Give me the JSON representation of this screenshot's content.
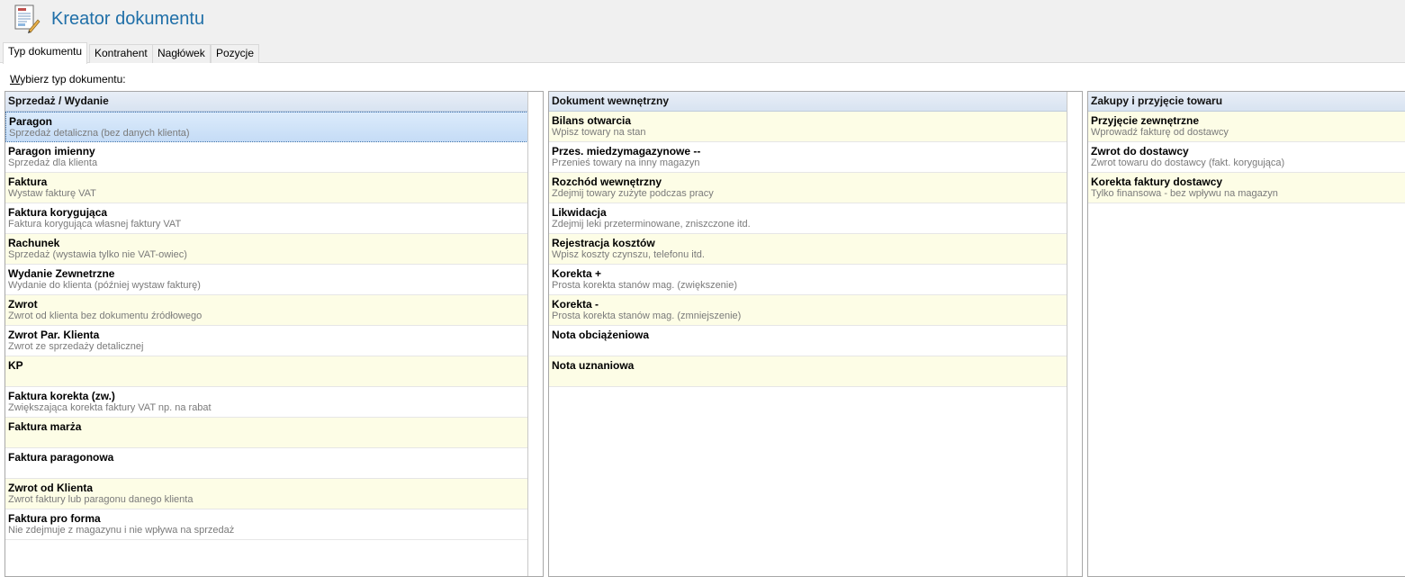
{
  "app": {
    "title": "Kreator dokumentu",
    "icon": "document-wizard-icon"
  },
  "tabs": [
    {
      "label": "Typ dokumentu",
      "active": true
    },
    {
      "label": "Kontrahent",
      "active": false
    },
    {
      "label": "Nagłówek",
      "active": false
    },
    {
      "label": "Pozycje",
      "active": false
    }
  ],
  "prompt": {
    "accel": "W",
    "rest": "ybierz typ dokumentu:"
  },
  "panels": [
    {
      "header": "Sprzedaż / Wydanie",
      "items": [
        {
          "title": "Paragon",
          "desc": "Sprzedaż detaliczna (bez danych klienta)",
          "selected": true
        },
        {
          "title": "Paragon imienny",
          "desc": "Sprzedaż dla klienta"
        },
        {
          "title": "Faktura",
          "desc": "Wystaw fakturę VAT"
        },
        {
          "title": "Faktura korygująca",
          "desc": "Faktura korygująca własnej faktury VAT"
        },
        {
          "title": "Rachunek",
          "desc": "Sprzedaż (wystawia tylko nie VAT-owiec)"
        },
        {
          "title": "Wydanie Zewnetrzne",
          "desc": "Wydanie do klienta (później wystaw fakturę)"
        },
        {
          "title": "Zwrot",
          "desc": "Zwrot od klienta bez dokumentu źródłowego"
        },
        {
          "title": "Zwrot Par. Klienta",
          "desc": "Zwrot ze sprzedaży detalicznej"
        },
        {
          "title": "KP",
          "desc": ""
        },
        {
          "title": "Faktura korekta (zw.)",
          "desc": "Zwiększająca korekta faktury VAT np. na rabat"
        },
        {
          "title": "Faktura marża",
          "desc": ""
        },
        {
          "title": "Faktura paragonowa",
          "desc": ""
        },
        {
          "title": "Zwrot od  Klienta",
          "desc": "Zwrot faktury lub paragonu danego klienta"
        },
        {
          "title": "Faktura pro forma",
          "desc": "Nie zdejmuje z magazynu i nie wpływa na sprzedaż"
        }
      ]
    },
    {
      "header": "Dokument wewnętrzny",
      "items": [
        {
          "title": "Bilans otwarcia",
          "desc": "Wpisz towary na stan"
        },
        {
          "title": "Przes. miedzymagazynowe --",
          "desc": "Przenieś towary na inny magazyn"
        },
        {
          "title": "Rozchód wewnętrzny",
          "desc": "Zdejmij towary zużyte podczas pracy"
        },
        {
          "title": "Likwidacja",
          "desc": "Zdejmij leki przeterminowane, zniszczone itd."
        },
        {
          "title": "Rejestracja kosztów",
          "desc": "Wpisz koszty czynszu, telefonu itd."
        },
        {
          "title": "Korekta +",
          "desc": "Prosta korekta stanów mag. (zwiększenie)"
        },
        {
          "title": "Korekta -",
          "desc": "Prosta korekta stanów mag. (zmniejszenie)"
        },
        {
          "title": "Nota obciążeniowa",
          "desc": ""
        },
        {
          "title": "Nota uznaniowa",
          "desc": ""
        }
      ]
    },
    {
      "header": "Zakupy i przyjęcie towaru",
      "items": [
        {
          "title": "Przyjęcie zewnętrzne",
          "desc": "Wprowadź fakturę od dostawcy"
        },
        {
          "title": "Zwrot do dostawcy",
          "desc": "Zwrot towaru do dostawcy (fakt. korygująca)"
        },
        {
          "title": "Korekta faktury dostawcy",
          "desc": "Tylko finansowa - bez wpływu na magazyn"
        }
      ]
    }
  ]
}
